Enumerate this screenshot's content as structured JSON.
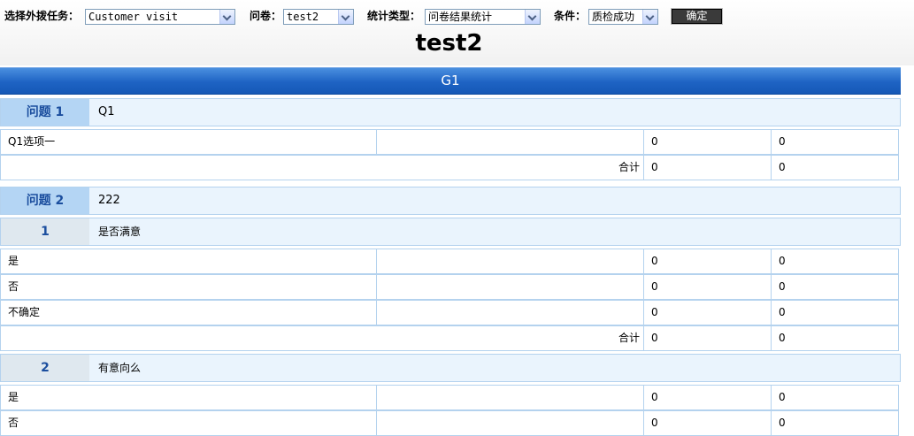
{
  "filters": {
    "task_label": "选择外拨任务：",
    "task_value": "Customer visit",
    "questionnaire_label": "问卷：",
    "questionnaire_value": "test2",
    "stat_type_label": "统计类型：",
    "stat_type_value": "问卷结果统计",
    "condition_label": "条件：",
    "condition_value": "质检成功",
    "confirm_label": "确定"
  },
  "page_title": "test2",
  "group_title": "G1",
  "total_label": "合计",
  "questions": [
    {
      "num_label": "问题 1",
      "text": "Q1",
      "options": [
        {
          "label": "Q1选项一",
          "v1": "0",
          "v2": "0"
        }
      ],
      "total": {
        "v1": "0",
        "v2": "0"
      }
    },
    {
      "num_label": "问题 2",
      "text": "222",
      "subquestions": [
        {
          "num": "1",
          "text": "是否满意",
          "options": [
            {
              "label": "是",
              "v1": "0",
              "v2": "0"
            },
            {
              "label": "否",
              "v1": "0",
              "v2": "0"
            },
            {
              "label": "不确定",
              "v1": "0",
              "v2": "0"
            }
          ],
          "total": {
            "v1": "0",
            "v2": "0"
          }
        },
        {
          "num": "2",
          "text": "有意向么",
          "options": [
            {
              "label": "是",
              "v1": "0",
              "v2": "0"
            },
            {
              "label": "否",
              "v1": "0",
              "v2": "0"
            }
          ]
        }
      ]
    }
  ],
  "colors": {
    "group_bar": "#1e63c4",
    "question_num_bg": "#b4d5f4",
    "header_bg": "#eaf4fd",
    "border": "#b4d2ee",
    "num_text": "#1b4e9e"
  },
  "icons": [
    "chevron-down-icon"
  ]
}
